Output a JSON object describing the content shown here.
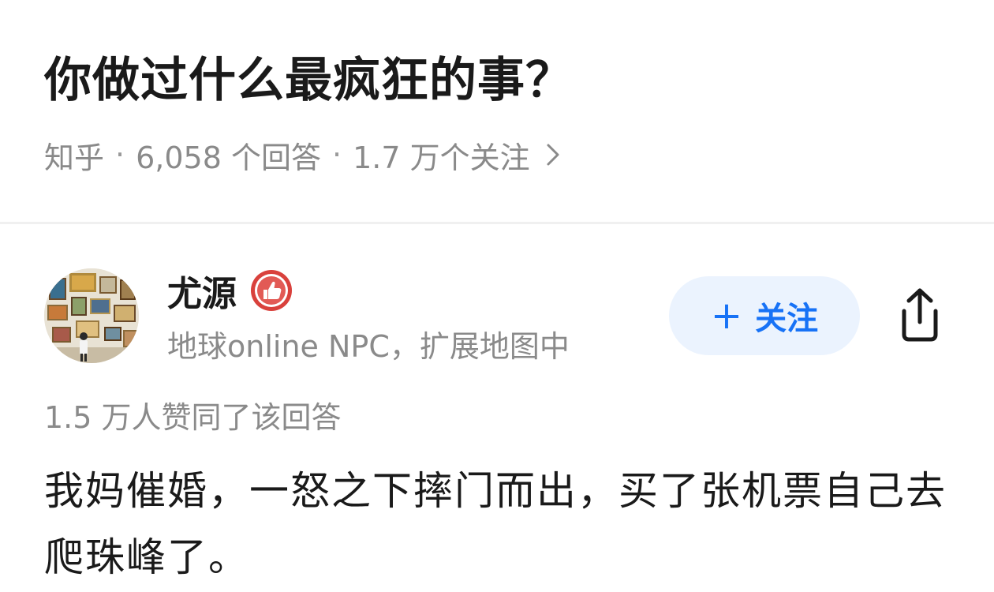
{
  "question": {
    "title": "你做过什么最疯狂的事？",
    "source": "知乎",
    "separator": "·",
    "answers_count": "6,058 个回答",
    "followers_count": "1.7 万个关注",
    "chevron": "›"
  },
  "author": {
    "name": "尤源",
    "bio": "地球online NPC，扩展地图中",
    "badge_icon": "thumbs-up-badge-icon",
    "avatar_icon": "gallery-wall-avatar"
  },
  "actions": {
    "follow_plus": "+",
    "follow_label": "关注",
    "share_icon": "share-icon"
  },
  "answer": {
    "vote_summary": "1.5 万人赞同了该回答",
    "text": "我妈催婚，一怒之下摔门而出，买了张机票自己去爬珠峰了。"
  },
  "colors": {
    "accent": "#1772f6",
    "follow_bg": "#ebf3fe",
    "badge_red": "#d9413c",
    "text_primary": "#1a1a1a",
    "text_secondary": "#8a8a8a"
  }
}
